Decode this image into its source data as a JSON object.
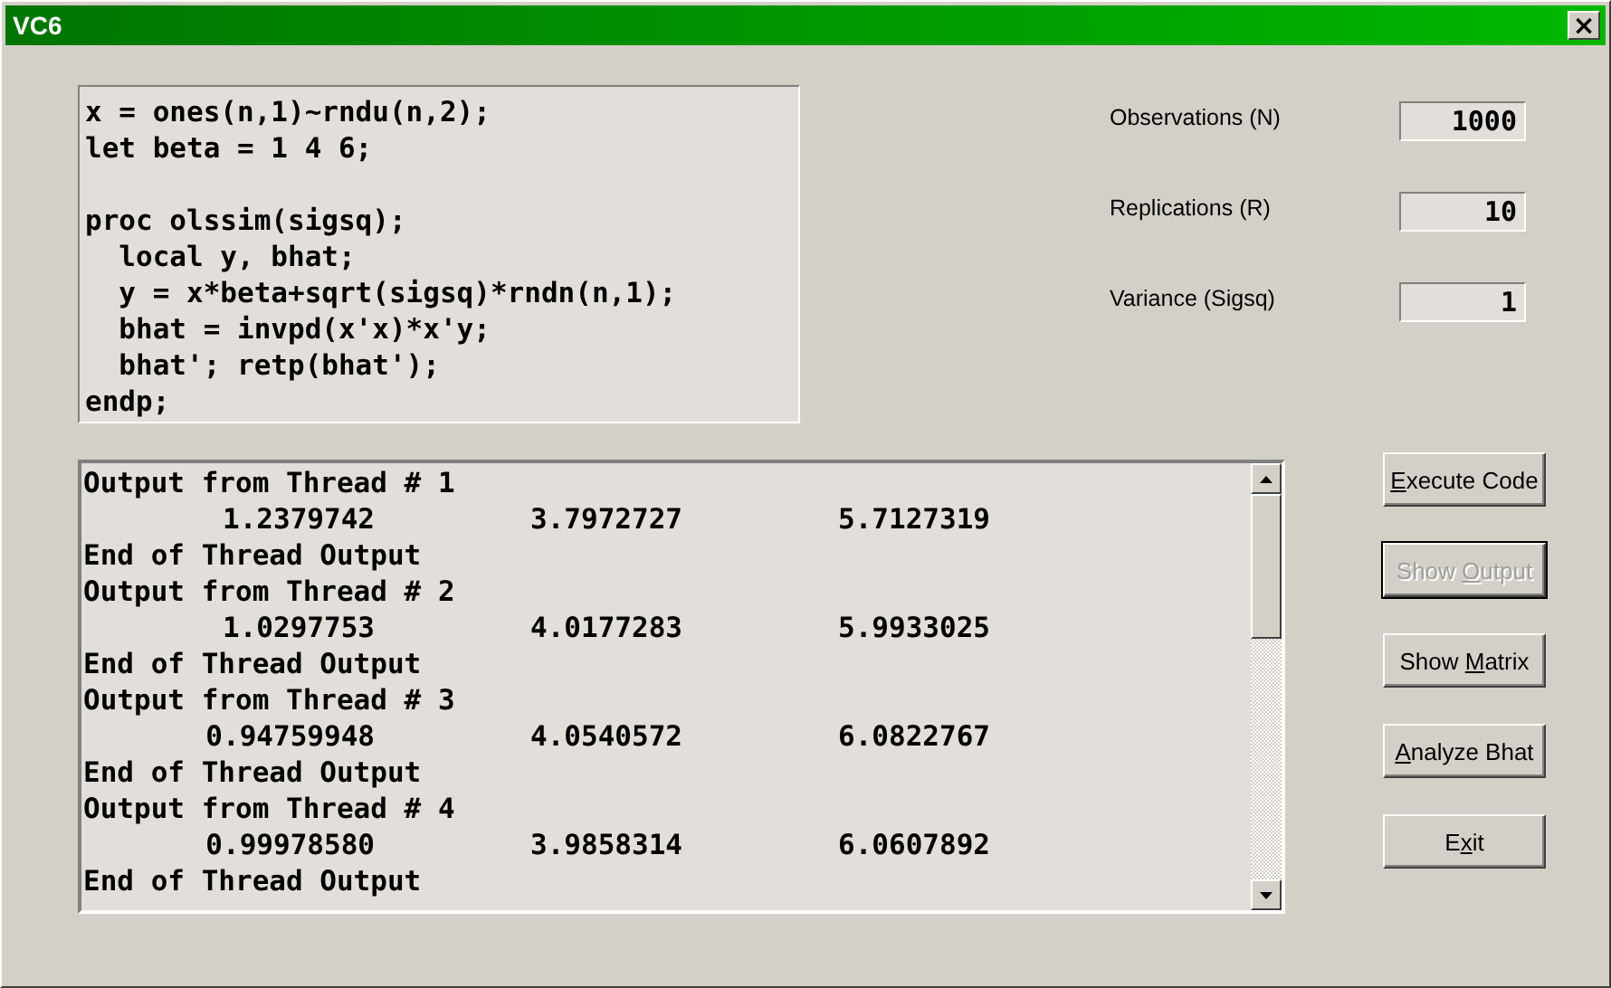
{
  "window": {
    "title": "VC6",
    "close": "×"
  },
  "code": "x = ones(n,1)~rndu(n,2);\nlet beta = 1 4 6;\n\nproc olssim(sigsq);\n  local y, bhat;\n  y = x*beta+sqrt(sigsq)*rndn(n,1);\n  bhat = invpd(x'x)*x'y;\n  bhat'; retp(bhat');\nendp;",
  "parameters": [
    {
      "label": "Observations (N)",
      "value": "1000"
    },
    {
      "label": "Replications (R)",
      "value": "10"
    },
    {
      "label": "Variance (Sigsq)",
      "value": "1"
    }
  ],
  "output": [
    {
      "kind": "text",
      "text": "Output from Thread # 1"
    },
    {
      "kind": "values",
      "values": [
        "1.2379742",
        "3.7972727",
        "5.7127319"
      ]
    },
    {
      "kind": "text",
      "text": "End of Thread Output"
    },
    {
      "kind": "text",
      "text": "Output from Thread # 2"
    },
    {
      "kind": "values",
      "values": [
        "1.0297753",
        "4.0177283",
        "5.9933025"
      ]
    },
    {
      "kind": "text",
      "text": "End of Thread Output"
    },
    {
      "kind": "text",
      "text": "Output from Thread # 3"
    },
    {
      "kind": "values",
      "values": [
        "0.94759948",
        "4.0540572",
        "6.0822767"
      ]
    },
    {
      "kind": "text",
      "text": "End of Thread Output"
    },
    {
      "kind": "text",
      "text": "Output from Thread # 4"
    },
    {
      "kind": "values",
      "values": [
        "0.99978580",
        "3.9858314",
        "6.0607892"
      ]
    },
    {
      "kind": "text",
      "text": "End of Thread Output"
    }
  ],
  "buttons": [
    {
      "mnemonic": "E",
      "after": "xecute Code",
      "disabled": false,
      "focused": false
    },
    {
      "before": "Show ",
      "mnemonic": "O",
      "after": "utput",
      "disabled": true,
      "focused": true
    },
    {
      "before": "Show ",
      "mnemonic": "M",
      "after": "atrix",
      "disabled": false,
      "focused": false
    },
    {
      "mnemonic": "A",
      "after": "nalyze Bhat",
      "disabled": false,
      "focused": false
    },
    {
      "before": "E",
      "mnemonic": "x",
      "after": "it",
      "disabled": false,
      "focused": false
    }
  ]
}
